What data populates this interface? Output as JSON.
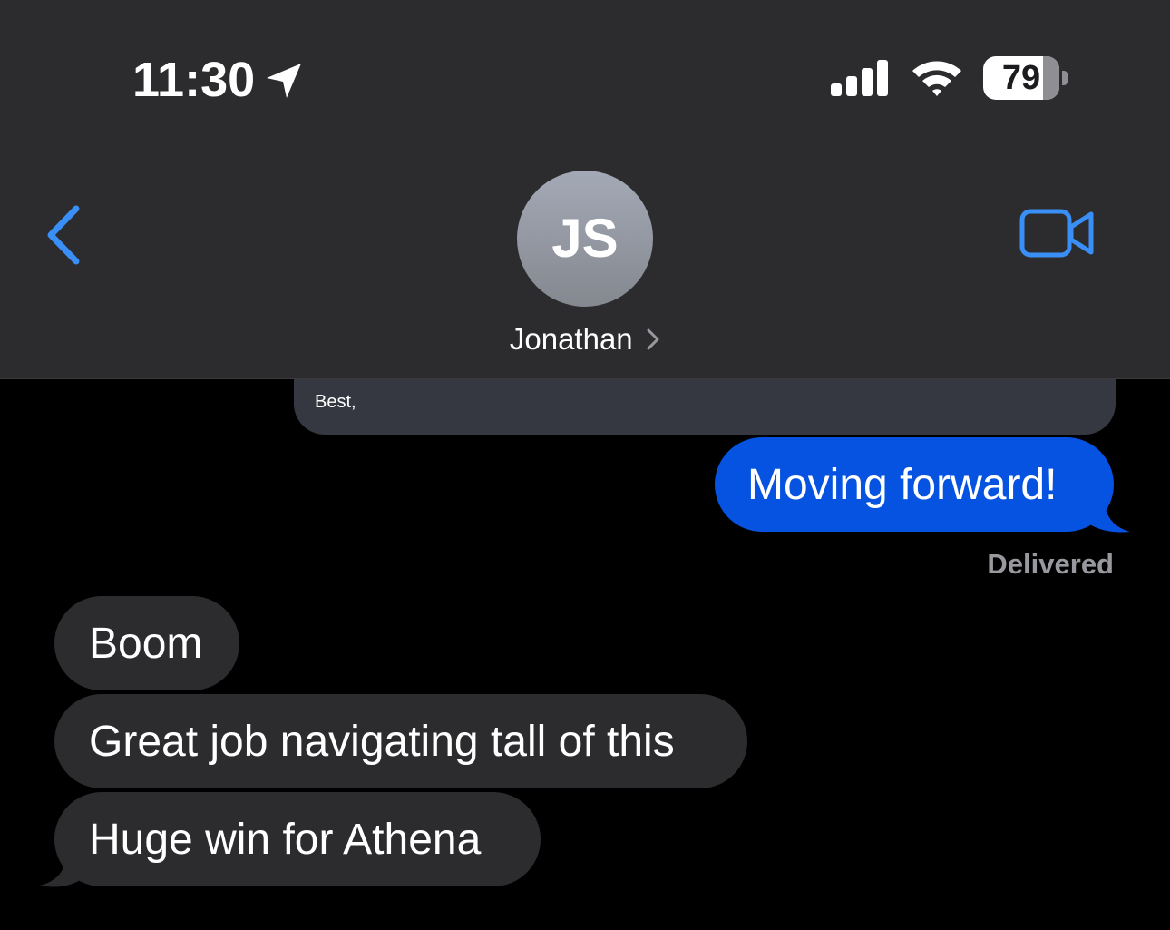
{
  "status_bar": {
    "time": "11:30",
    "battery": "79",
    "icons": [
      "location-arrow-icon",
      "cellular-signal-icon",
      "wifi-icon",
      "battery-icon"
    ]
  },
  "header": {
    "back_icon": "chevron-left-icon",
    "avatar_initials": "JS",
    "contact_name": "Jonathan",
    "contact_chevron_icon": "chevron-right-icon",
    "video_icon": "video-camera-icon"
  },
  "colors": {
    "accent": "#3a8ff7",
    "sent_bubble": "#0553e0",
    "received_bubble": "#2c2c2e",
    "header_bg": "#2c2c2e"
  },
  "messages": {
    "email_preview_text": "Best,",
    "sent": [
      {
        "text": "Moving forward!"
      }
    ],
    "sent_status": "Delivered",
    "received": [
      {
        "text": "Boom"
      },
      {
        "text": "Great job navigating tall of this"
      },
      {
        "text": "Huge win for Athena"
      }
    ]
  }
}
